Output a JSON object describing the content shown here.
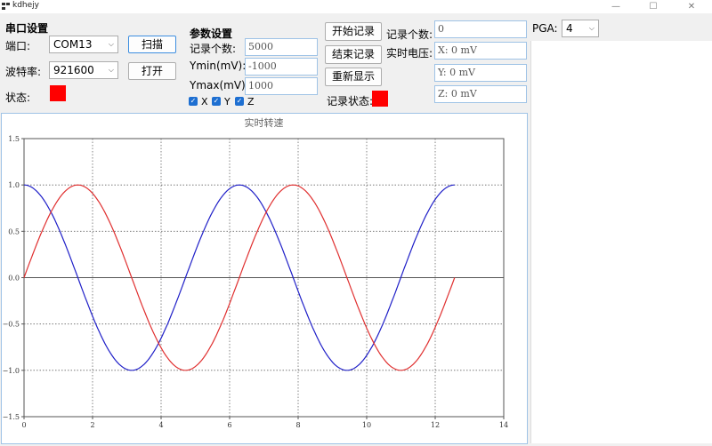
{
  "window": {
    "title": "kdhejy",
    "minimize": "—",
    "maximize": "☐",
    "close": "✕"
  },
  "serial": {
    "header": "串口设置",
    "port_label": "端口:",
    "port_value": "COM13",
    "baud_label": "波特率:",
    "baud_value": "921600",
    "status_label": "状态:",
    "status_color": "#ff0000",
    "scan_button": "扫描",
    "open_button": "打开"
  },
  "params": {
    "header": "参数设置",
    "count_label": "记录个数:",
    "count_value": "5000",
    "ymin_label": "Ymin(mV):",
    "ymin_value": "-1000",
    "ymax_label": "Ymax(mV):",
    "ymax_value": "1000",
    "checkboxes": [
      {
        "label": "X"
      },
      {
        "label": "Y"
      },
      {
        "label": "Z"
      }
    ]
  },
  "record": {
    "start_button": "开始记录",
    "stop_button": "结束记录",
    "redisplay_button": "重新显示",
    "state_label": "记录状态:",
    "state_color": "#ff0000",
    "count_label": "记录个数:",
    "count_value": "0",
    "voltage_label": "实时电压:",
    "x_value": "X: 0  mV",
    "y_value": "Y: 0  mV",
    "z_value": "Z: 0  mV"
  },
  "pga": {
    "label": "PGA:",
    "value": "4"
  },
  "chart_data": {
    "type": "line",
    "title": "实时转速",
    "xlim": [
      0,
      14
    ],
    "ylim": [
      -1.5,
      1.5
    ],
    "x_ticks": [
      0,
      2,
      4,
      6,
      8,
      10,
      12,
      14
    ],
    "y_ticks": [
      1.5,
      1.0,
      0.5,
      0.0,
      -0.5,
      -1.0,
      -1.5
    ],
    "x_tick_labels": [
      "0",
      "2",
      "4",
      "6",
      "8",
      "10",
      "12",
      "14"
    ],
    "y_tick_labels": [
      "1.5",
      "1.0",
      "0.5",
      "0.0",
      "−0.5",
      "−1.0",
      "−1.5"
    ],
    "grid": true,
    "series": [
      {
        "color": "#2020c8",
        "function": "cos",
        "x_range": [
          0,
          12.566
        ]
      },
      {
        "color": "#e03030",
        "function": "sin",
        "x_range": [
          0,
          12.566
        ]
      }
    ]
  }
}
